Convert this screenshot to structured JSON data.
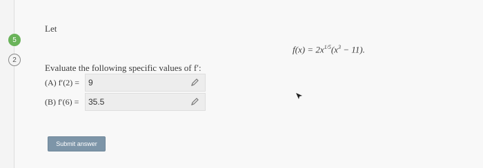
{
  "side": {
    "badge_top": "5",
    "badge_bottom": "2"
  },
  "question": {
    "intro": "Let",
    "function_lhs": "f(x) = 2x",
    "function_exp": "1/5",
    "function_mid": "(x",
    "function_exp2": "3",
    "function_tail": " − 11).",
    "prompt": "Evaluate the following specific values of f′:"
  },
  "answers": [
    {
      "label": "(A) f′(2) =",
      "value": "9"
    },
    {
      "label": "(B) f′(6) =",
      "value": "35.5"
    }
  ],
  "submit_label": "Submit answer",
  "icons": {
    "edit": "pencil-icon",
    "pointer": "mouse-cursor-icon"
  }
}
